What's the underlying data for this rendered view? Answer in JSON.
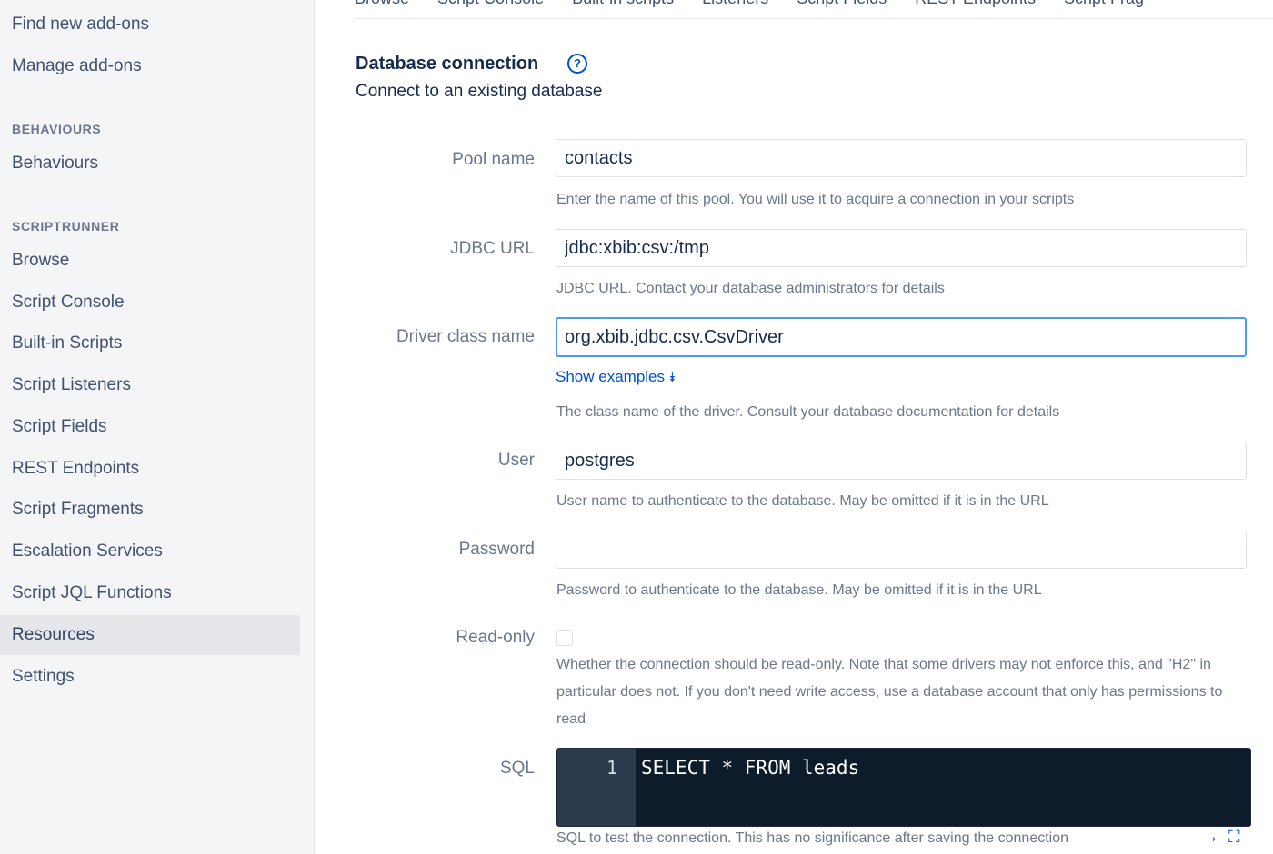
{
  "sidebar": {
    "top_links": [
      "Find new add-ons",
      "Manage add-ons"
    ],
    "behaviours_heading": "BEHAVIOURS",
    "behaviours_items": [
      "Behaviours"
    ],
    "scriptrunner_heading": "SCRIPTRUNNER",
    "scriptrunner_items": [
      "Browse",
      "Script Console",
      "Built-in Scripts",
      "Script Listeners",
      "Script Fields",
      "REST Endpoints",
      "Script Fragments",
      "Escalation Services",
      "Script JQL Functions",
      "Resources",
      "Settings"
    ],
    "active_item": "Resources"
  },
  "tabs": [
    "Browse",
    "Script Console",
    "Built-in scripts",
    "Listeners",
    "Script Fields",
    "REST Endpoints",
    "Script Frag"
  ],
  "form": {
    "title": "Database connection",
    "help_icon": "question-circle-icon",
    "description": "Connect to an existing database",
    "pool_name": {
      "label": "Pool name",
      "value": "contacts",
      "hint": "Enter the name of this pool. You will use it to acquire a connection in your scripts"
    },
    "jdbc_url": {
      "label": "JDBC URL",
      "value": "jdbc:xbib:csv:/tmp",
      "hint": "JDBC URL. Contact your database administrators for details"
    },
    "driver_class": {
      "label": "Driver class name",
      "value": "org.xbib.jdbc.csv.CsvDriver",
      "show_examples": "Show examples",
      "hint": "The class name of the driver. Consult your database documentation for details"
    },
    "user": {
      "label": "User",
      "value": "postgres",
      "hint": "User name to authenticate to the database. May be omitted if it is in the URL"
    },
    "password": {
      "label": "Password",
      "value": "",
      "hint": "Password to authenticate to the database. May be omitted if it is in the URL"
    },
    "read_only": {
      "label": "Read-only",
      "checked": false,
      "hint": "Whether the connection should be read-only. Note that some drivers may not enforce this, and \"H2\" in particular does not. If you don't need write access, use a database account that only has permissions to read"
    },
    "sql": {
      "label": "SQL",
      "line_number": "1",
      "code": "SELECT * FROM leads",
      "hint": "SQL to test the connection. This has no significance after saving the connection"
    }
  }
}
